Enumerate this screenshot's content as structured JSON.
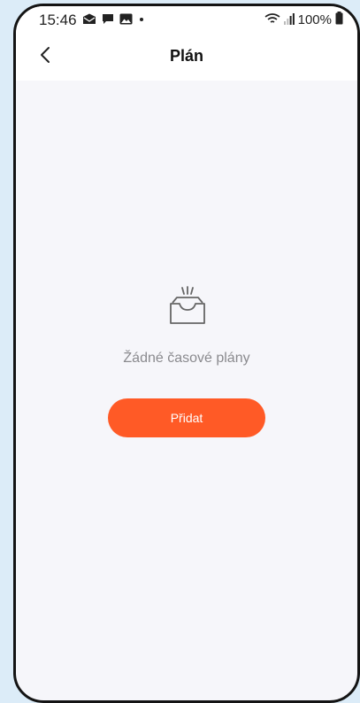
{
  "status_bar": {
    "time": "15:46",
    "battery": "100%",
    "icons": [
      "mail-icon",
      "chat-icon",
      "image-icon",
      "dot-icon",
      "wifi-icon",
      "signal-icon",
      "battery-icon"
    ]
  },
  "header": {
    "title": "Plán",
    "back_icon": "chevron-left-icon"
  },
  "empty_state": {
    "icon": "empty-inbox-icon",
    "message": "Žádné časové plány",
    "add_button_label": "Přidat"
  },
  "colors": {
    "accent": "#ff5a26",
    "background": "#f6f6fa",
    "header_bg": "#ffffff",
    "muted_text": "#8a8a8e"
  }
}
